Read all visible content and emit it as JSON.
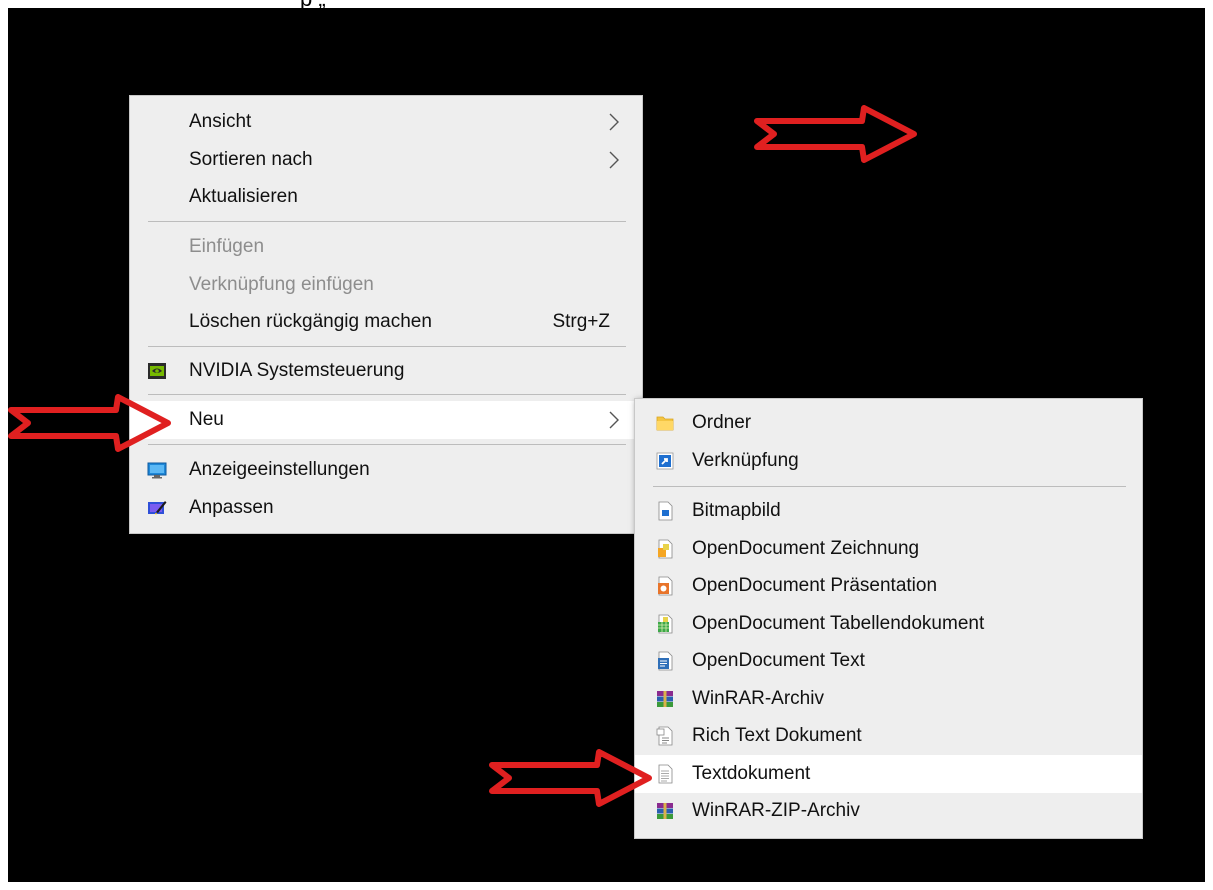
{
  "caption": "p „ “",
  "main_menu": {
    "items": [
      {
        "label": "Ansicht",
        "submenu": true
      },
      {
        "label": "Sortieren nach",
        "submenu": true
      },
      {
        "label": "Aktualisieren"
      },
      {
        "label": "Einfügen",
        "disabled": true
      },
      {
        "label": "Verknüpfung einfügen",
        "disabled": true
      },
      {
        "label": "Löschen rückgängig machen",
        "shortcut": "Strg+Z"
      },
      {
        "label": "NVIDIA Systemsteuerung",
        "icon": "nvidia-icon"
      },
      {
        "label": "Neu",
        "submenu": true,
        "highlighted": true
      },
      {
        "label": "Anzeigeeinstellungen",
        "icon": "display-icon"
      },
      {
        "label": "Anpassen",
        "icon": "personalize-icon"
      }
    ]
  },
  "sub_menu": {
    "items": [
      {
        "label": "Ordner",
        "icon": "folder-icon"
      },
      {
        "label": "Verknüpfung",
        "icon": "shortcut-icon"
      },
      {
        "label": "Bitmapbild",
        "icon": "bitmap-icon"
      },
      {
        "label": "OpenDocument Zeichnung",
        "icon": "odg-icon"
      },
      {
        "label": "OpenDocument Präsentation",
        "icon": "odp-icon"
      },
      {
        "label": "OpenDocument Tabellendokument",
        "icon": "ods-icon"
      },
      {
        "label": "OpenDocument Text",
        "icon": "odt-icon"
      },
      {
        "label": "WinRAR-Archiv",
        "icon": "winrar-icon"
      },
      {
        "label": "Rich Text Dokument",
        "icon": "rtf-icon"
      },
      {
        "label": "Textdokument",
        "icon": "text-document-icon",
        "highlighted": true
      },
      {
        "label": "WinRAR-ZIP-Archiv",
        "icon": "winrar-zip-icon"
      }
    ]
  },
  "colors": {
    "desktop": "#000000",
    "menu_bg": "#eeeeee",
    "highlight": "#ffffff",
    "annotation_arrow": "#e02020"
  }
}
